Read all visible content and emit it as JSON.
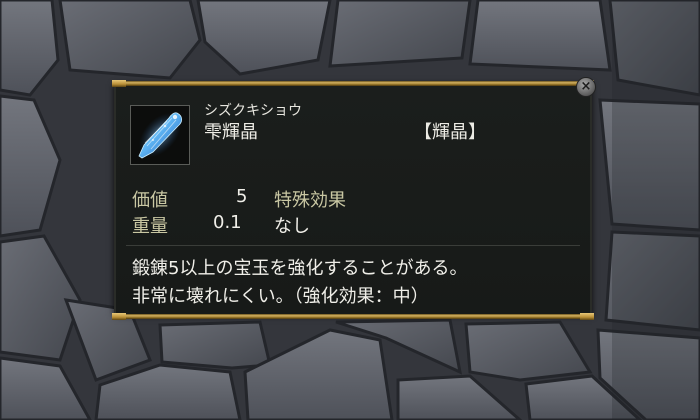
{
  "item": {
    "reading": "シズクキショウ",
    "name": "雫輝晶",
    "category": "【輝晶】",
    "icon": "blue-crystal-icon"
  },
  "stats": {
    "value_label": "価値",
    "value": "5",
    "weight_label": "重量",
    "weight": "0.1",
    "effect_label": "特殊効果",
    "effect": "なし"
  },
  "description": {
    "line1": "鍛錬5以上の宝玉を強化することがある。",
    "line2": "非常に壊れにくい。（強化効果：中）"
  },
  "close_icon": "×",
  "colors": {
    "panel_bg": "#1a1d1b",
    "gold_trim": "#c9a553",
    "stat_label": "#c9c7a3",
    "text": "#ecebe4",
    "crystal": "#4fa8f0"
  }
}
